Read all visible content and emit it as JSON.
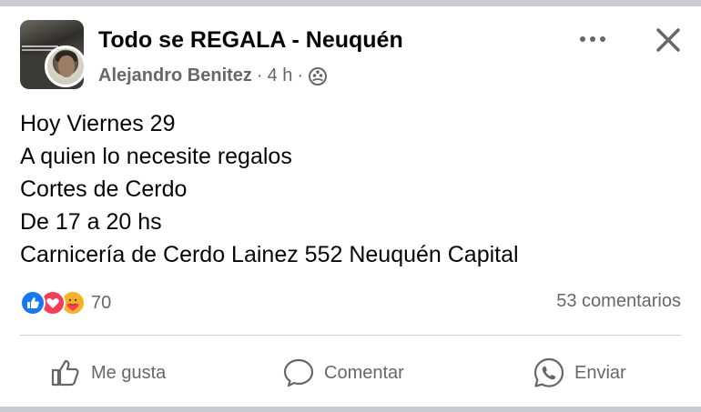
{
  "post": {
    "group_name": "Todo se REGALA - Neuquén",
    "author": "Alejandro Benitez",
    "separator": "·",
    "time": "4 h",
    "audience_icon": "group-audience-icon",
    "more_icon": "more-options-icon",
    "close_icon": "close-icon",
    "text_lines": [
      "Hoy Viernes 29",
      "A quien lo necesite regalos",
      "Cortes de Cerdo",
      "De 17 a 20 hs",
      "Carnicería de Cerdo Lainez 552 Neuquén Capital"
    ]
  },
  "stats": {
    "reaction_icons": [
      "like-reaction-icon",
      "love-reaction-icon",
      "care-reaction-icon"
    ],
    "reaction_count": "70",
    "comments": "53 comentarios"
  },
  "actions": {
    "like_label": "Me gusta",
    "comment_label": "Comentar",
    "share_label": "Enviar"
  },
  "colors": {
    "text": "#050505",
    "secondary": "#65676b",
    "like_blue": "#1877f2",
    "love_red": "#f33e58",
    "care_yellow": "#f7b125",
    "divider": "#ced0d4"
  }
}
